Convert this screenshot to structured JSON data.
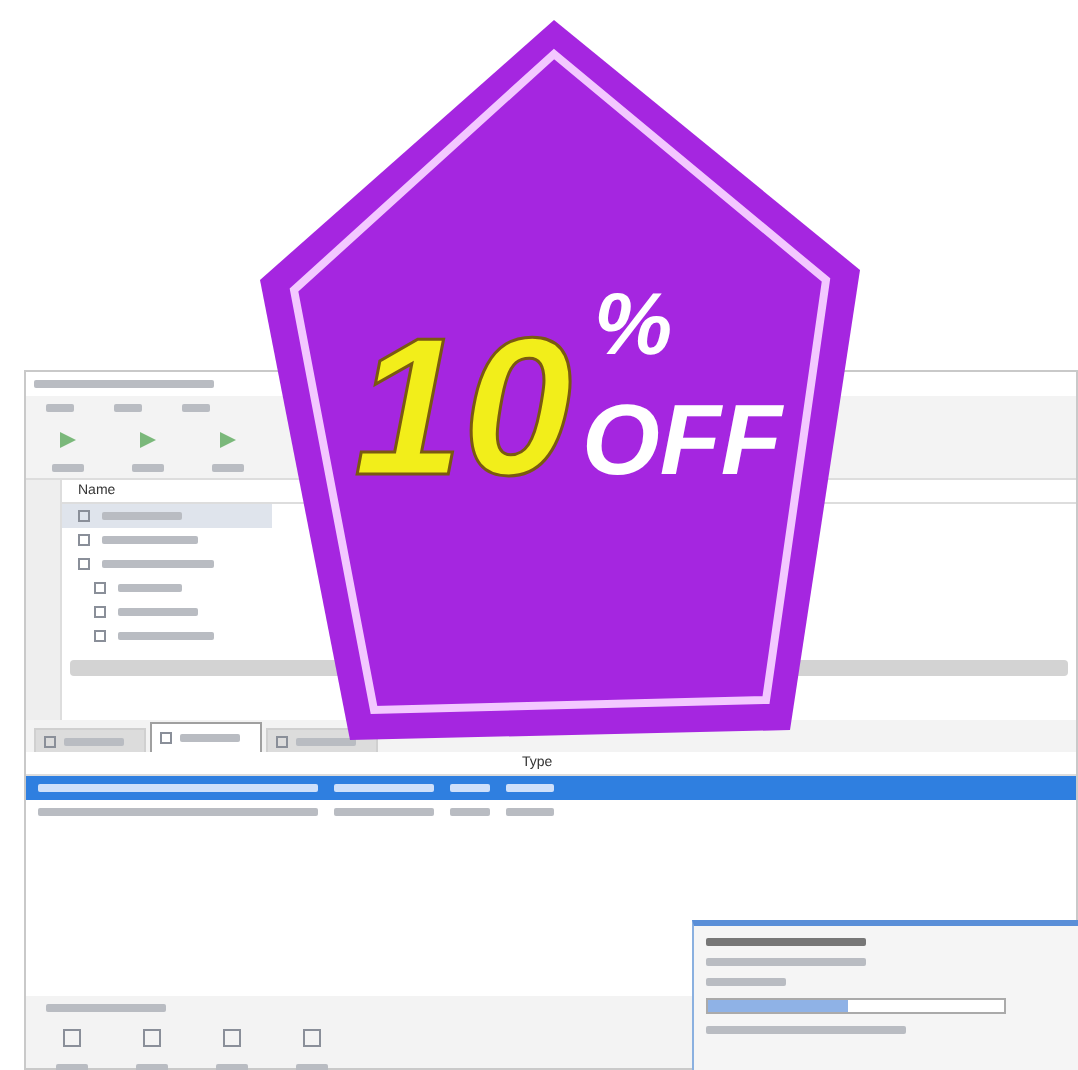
{
  "window": {
    "columns": [
      {
        "label": "Name"
      }
    ],
    "task_rows": [
      {
        "selected": true
      },
      {
        "selected": false
      },
      {
        "selected": false
      },
      {
        "selected": false
      },
      {
        "selected": false
      },
      {
        "selected": false
      }
    ],
    "tabs": [
      {
        "selected": false
      },
      {
        "selected": true
      },
      {
        "selected": false
      }
    ],
    "backup_columns": [
      {
        "label": "Type"
      }
    ],
    "backup_rows": [
      {
        "selected": true
      },
      {
        "selected": false
      }
    ]
  },
  "progress_dialog": {
    "level": 0.47
  },
  "badge": {
    "number": "10",
    "percent": "%",
    "label": "OFF"
  }
}
